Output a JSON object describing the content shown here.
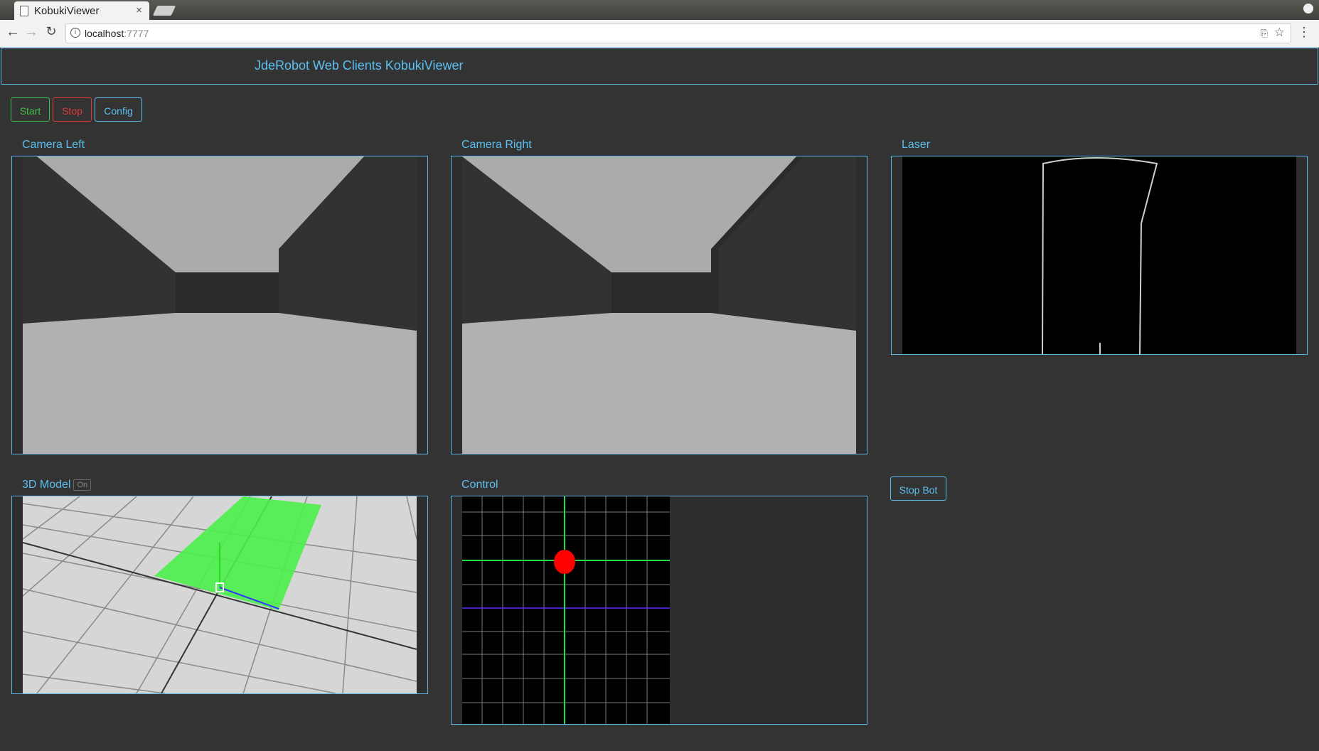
{
  "browser": {
    "tab_title": "KobukiViewer",
    "tab_close": "×",
    "url_host": "localhost",
    "url_port": ":7777"
  },
  "header": {
    "title": "JdeRobot Web Clients KobukiViewer"
  },
  "controls": {
    "start": "Start",
    "stop": "Stop",
    "config": "Config"
  },
  "panels": {
    "camera_left": "Camera Left",
    "camera_right": "Camera Right",
    "laser": "Laser",
    "model_3d": "3D Model",
    "model_toggle": "On",
    "control": "Control",
    "stop_bot": "Stop Bot"
  },
  "colors": {
    "accent": "#5bc0f0",
    "start": "#3fc04a",
    "stop": "#e23b3b",
    "background": "#333333"
  }
}
